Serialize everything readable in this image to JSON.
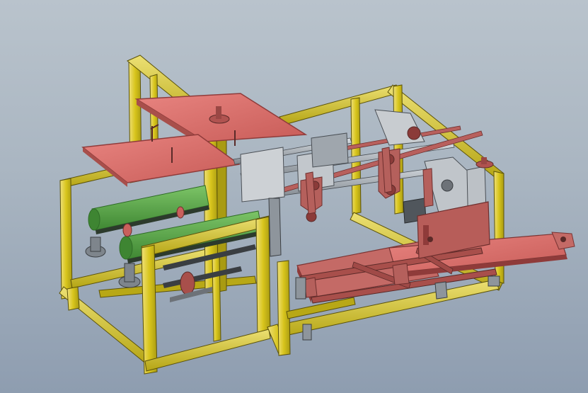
{
  "scene": {
    "subject": "cad-machine-assembly",
    "colors": {
      "frame_yellow": "#d8c51c",
      "frame_yellow_dark": "#8d7f10",
      "frame_yellow_light": "#efe07a",
      "plate_pink": "#d86a66",
      "plate_pink_dark": "#8f3b3a",
      "belt_green": "#5fa84c",
      "belt_green_dark": "#2f6c27",
      "steel_gray": "#9aa0a6",
      "steel_dark": "#4a4f55",
      "rust_red": "#a34d4b",
      "background_top": "#b9c3cc",
      "background_bottom": "#8e9db0"
    }
  }
}
